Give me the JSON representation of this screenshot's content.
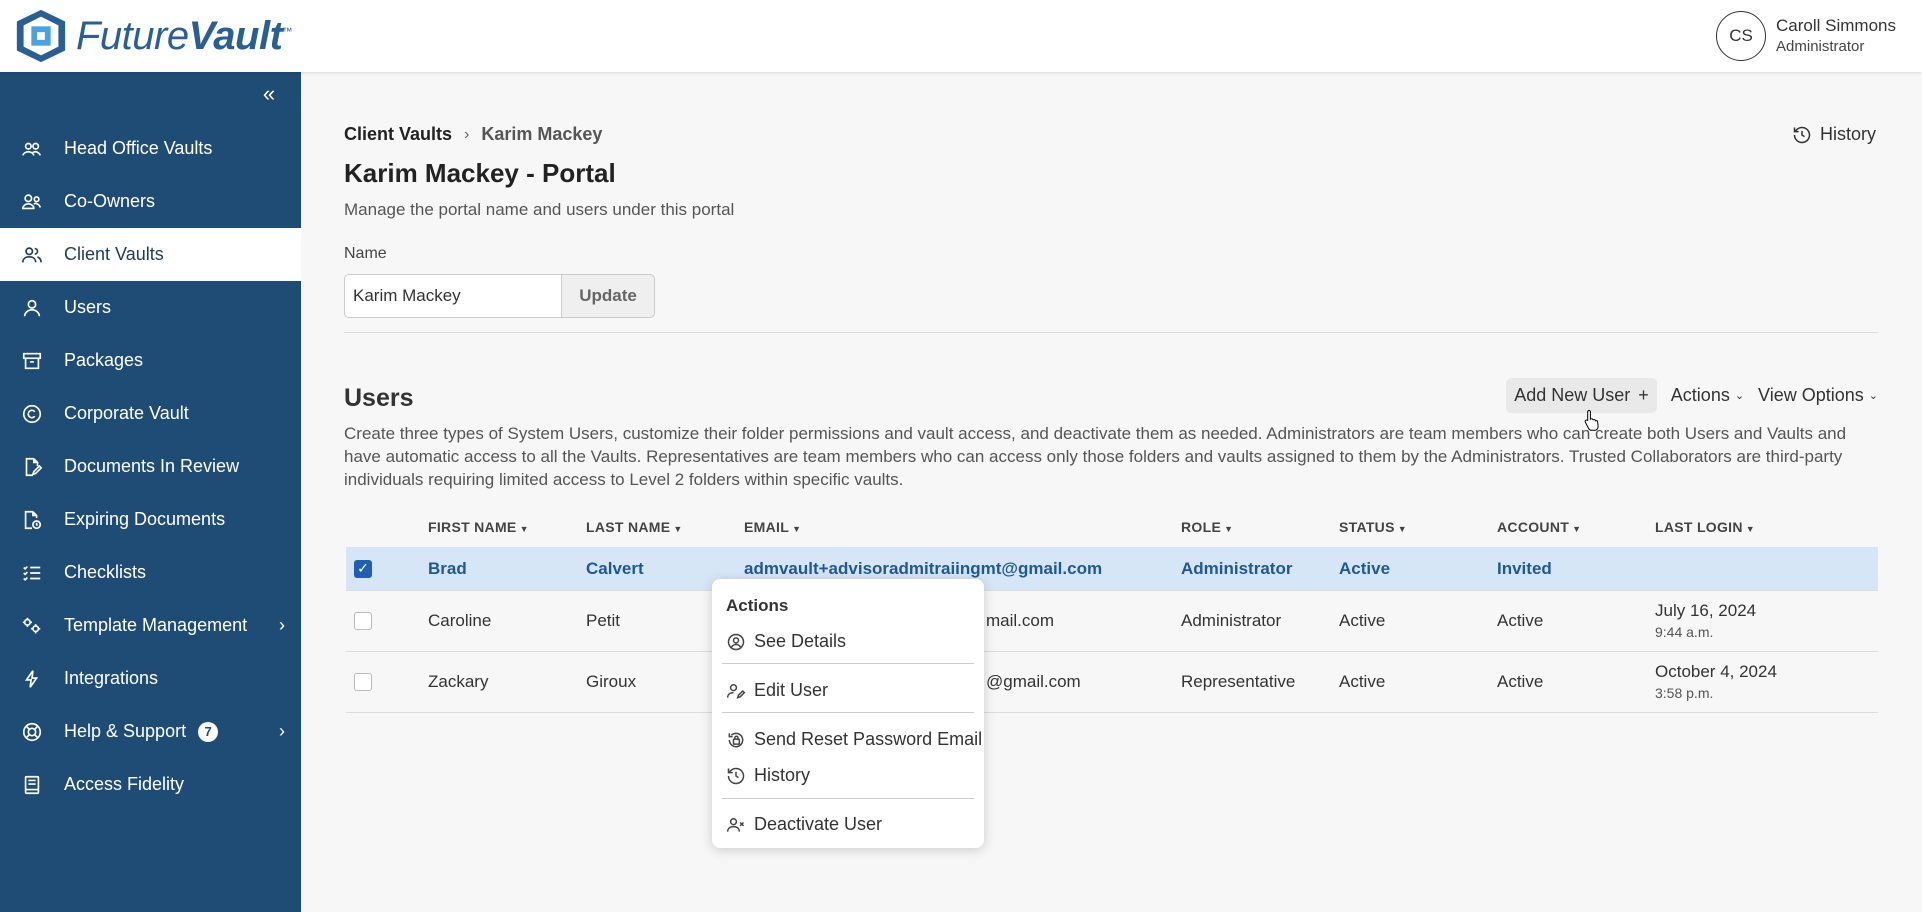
{
  "app": {
    "logo_text_light": "Future",
    "logo_text_bold": "Vault",
    "logo_tm": "™"
  },
  "user": {
    "initials": "CS",
    "name": "Caroll Simmons",
    "role": "Administrator"
  },
  "sidebar": {
    "collapse_label": "«",
    "items": [
      {
        "label": "Head Office Vaults",
        "icon": "people-group-icon"
      },
      {
        "label": "Co-Owners",
        "icon": "co-owners-icon"
      },
      {
        "label": "Client Vaults",
        "icon": "client-vaults-icon",
        "active": true
      },
      {
        "label": "Users",
        "icon": "user-icon"
      },
      {
        "label": "Packages",
        "icon": "package-icon"
      },
      {
        "label": "Corporate Vault",
        "icon": "copyright-icon"
      },
      {
        "label": "Documents In Review",
        "icon": "document-edit-icon"
      },
      {
        "label": "Expiring Documents",
        "icon": "document-clock-icon"
      },
      {
        "label": "Checklists",
        "icon": "checklist-icon"
      },
      {
        "label": "Template Management",
        "icon": "template-gear-icon",
        "chevron": true
      },
      {
        "label": "Integrations",
        "icon": "lightning-icon"
      },
      {
        "label": "Help & Support",
        "icon": "lifebuoy-icon",
        "badge": "7",
        "chevron": true
      },
      {
        "label": "Access Fidelity",
        "icon": "book-icon"
      }
    ]
  },
  "breadcrumb": {
    "parent": "Client Vaults",
    "current": "Karim Mackey"
  },
  "history_label": "History",
  "page": {
    "title": "Karim Mackey - Portal",
    "description": "Manage the portal name and users under this portal",
    "name_label": "Name",
    "name_value": "Karim Mackey",
    "update_label": "Update"
  },
  "users": {
    "title": "Users",
    "add_label": "Add New User",
    "actions_label": "Actions",
    "view_options_label": "View Options",
    "description": "Create three types of System Users, customize their folder permissions and vault access, and deactivate them as needed. Administrators are team members who can create both Users and Vaults and have automatic access to all the Vaults. Representatives are team members who can access only those folders and vaults assigned to them by the Administrators. Trusted Collaborators are third-party individuals requiring limited access to Level 2 folders within specific vaults.",
    "columns": [
      "FIRST NAME",
      "LAST NAME",
      "EMAIL",
      "ROLE",
      "STATUS",
      "ACCOUNT",
      "LAST LOGIN"
    ],
    "rows": [
      {
        "first": "Brad",
        "last": "Calvert",
        "email": "admvault+advisoradmitraiingmt@gmail.com",
        "role": "Administrator",
        "status": "Active",
        "account": "Invited",
        "login_date": "",
        "login_time": "",
        "checked": true
      },
      {
        "first": "Caroline",
        "last": "Petit",
        "email": "mail.com",
        "role": "Administrator",
        "status": "Active",
        "account": "Active",
        "login_date": "July 16, 2024",
        "login_time": "9:44 a.m.",
        "checked": false
      },
      {
        "first": "Zackary",
        "last": "Giroux",
        "email": "@gmail.com",
        "role": "Representative",
        "status": "Active",
        "account": "Active",
        "login_date": "October 4, 2024",
        "login_time": "3:58 p.m.",
        "checked": false
      }
    ]
  },
  "actions_menu": {
    "title": "Actions",
    "items": [
      "See Details",
      "Edit User",
      "Send Reset Password Email",
      "History",
      "Deactivate User"
    ]
  },
  "colors": {
    "sidebar_bg": "#1f4c75",
    "selected_row_bg": "#d7e6f7",
    "selected_row_text": "#1f5894",
    "brand": "#2a5f93"
  }
}
